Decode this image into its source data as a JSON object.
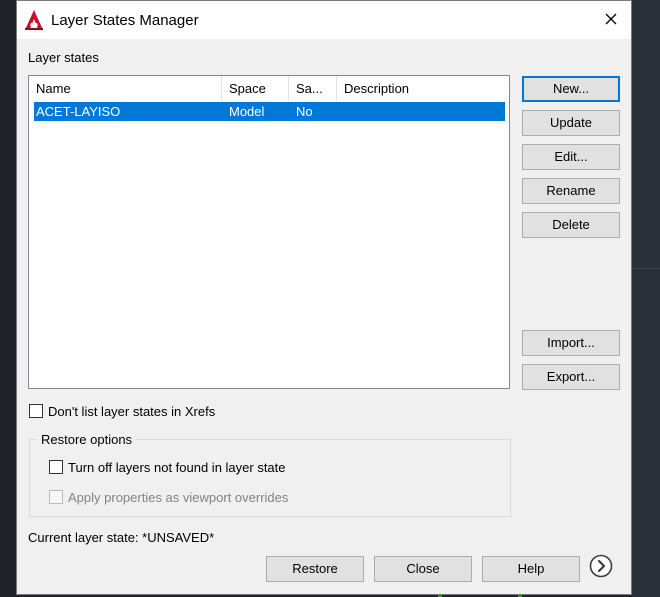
{
  "window": {
    "title": "Layer States Manager",
    "close_glyph": "✕"
  },
  "layer_states": {
    "label": "Layer states",
    "columns": [
      {
        "key": "name",
        "label": "Name"
      },
      {
        "key": "space",
        "label": "Space"
      },
      {
        "key": "same",
        "label": "Sa..."
      },
      {
        "key": "description",
        "label": "Description"
      }
    ],
    "rows": [
      {
        "name": "ACET-LAYISO",
        "space": "Model",
        "same": "No",
        "description": "",
        "selected": true
      }
    ]
  },
  "buttons": {
    "new": "New...",
    "update": "Update",
    "edit": "Edit...",
    "rename": "Rename",
    "delete": "Delete",
    "import": "Import...",
    "export": "Export..."
  },
  "options": {
    "dont_list_xrefs": {
      "label": "Don't list layer states in Xrefs",
      "checked": false
    },
    "restore_options_title": "Restore options",
    "turn_off_layers": {
      "label": "Turn off layers not found in layer state",
      "checked": false
    },
    "apply_viewport_overrides": {
      "label": "Apply properties as viewport overrides",
      "checked": false,
      "disabled": true
    }
  },
  "current_state": {
    "text": "Current layer state: *UNSAVED*"
  },
  "footer": {
    "restore": "Restore",
    "close": "Close",
    "help": "Help"
  },
  "colors": {
    "selection": "#0078d7",
    "app_icon_red": "#c8102e",
    "dialog_bg": "#f0f0f0"
  },
  "icons": {
    "app": "autocad-logo-icon",
    "close": "close-icon",
    "more": "chevron-right-circle-icon"
  }
}
